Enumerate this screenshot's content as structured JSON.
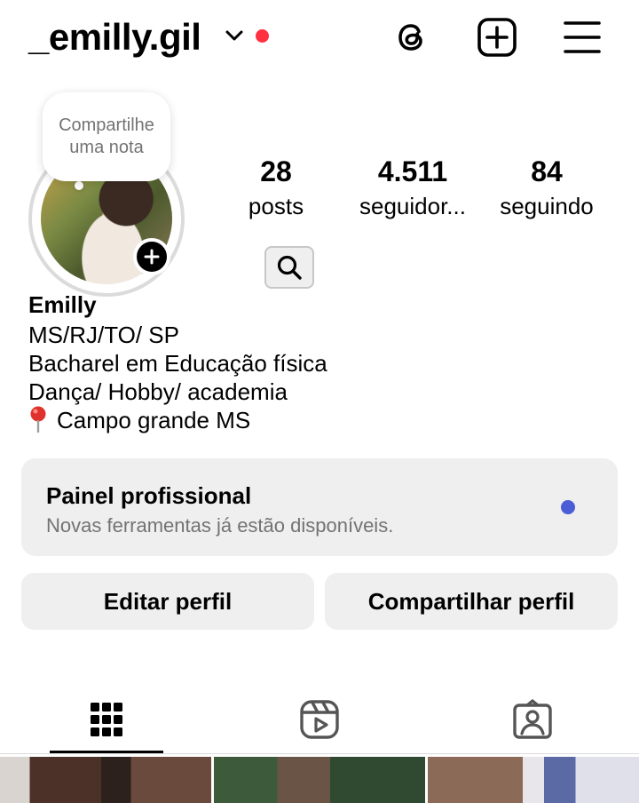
{
  "header": {
    "username": "_emilly.gil",
    "icons": [
      "chevron-down-icon",
      "threads-icon",
      "new-post-icon",
      "menu-icon"
    ],
    "notification_color": "#ff3040"
  },
  "profile": {
    "note_placeholder": "Compartilhe uma nota",
    "stats": {
      "posts_value": "28",
      "posts_label": "posts",
      "followers_value": "4.511",
      "followers_label": "seguidor...",
      "following_value": "84",
      "following_label": "seguindo"
    },
    "name": "Emilly",
    "bio": [
      "MS/RJ/TO/ SP",
      "Bacharel em Educação física",
      "Dança/ Hobby/ academia",
      "Campo grande MS"
    ]
  },
  "professional_panel": {
    "title": "Painel profissional",
    "subtitle": "Novas ferramentas já estão disponíveis.",
    "dot_color": "#4a5dd6"
  },
  "actions": {
    "edit_label": "Editar perfil",
    "share_label": "Compartilhar perfil"
  },
  "tabs": {
    "items": [
      "grid-icon",
      "reels-icon",
      "tagged-icon"
    ],
    "selected": "grid-icon"
  }
}
